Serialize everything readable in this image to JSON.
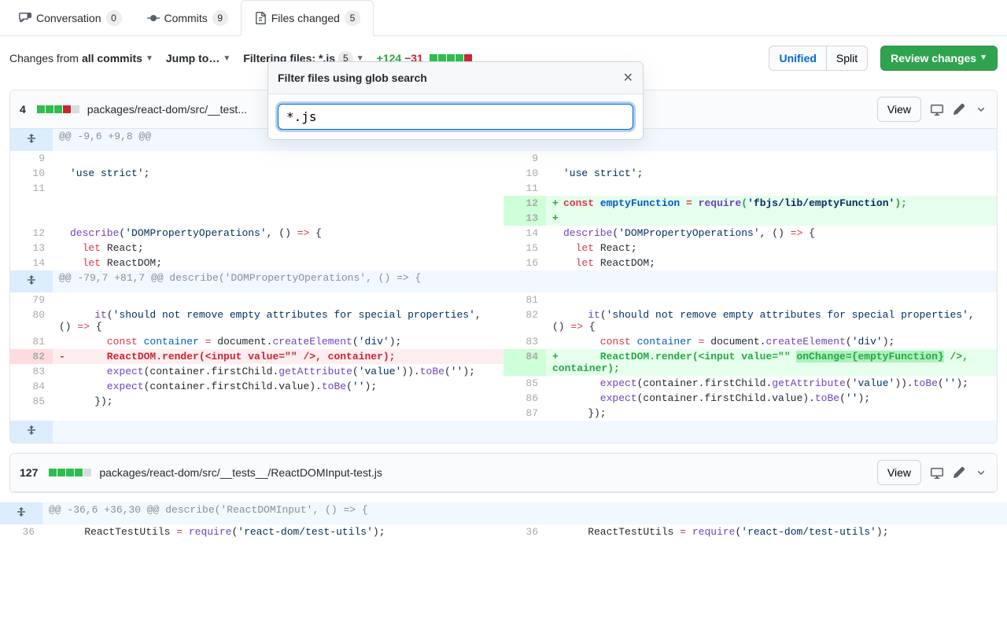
{
  "tabs": {
    "conversation": {
      "label": "Conversation",
      "count": "0"
    },
    "commits": {
      "label": "Commits",
      "count": "9"
    },
    "files": {
      "label": "Files changed",
      "count": "5"
    }
  },
  "toolbar": {
    "changes_from": "Changes from",
    "all_commits": "all commits",
    "jump_to": "Jump to…",
    "filtering": "Filtering files:",
    "filter_pattern": "*.js",
    "filter_count": "5",
    "additions": "+124",
    "deletions": "−31",
    "unified": "Unified",
    "split": "Split",
    "review": "Review changes"
  },
  "popover": {
    "title": "Filter files using glob search",
    "value": "*.js"
  },
  "file1": {
    "changes": "4",
    "path": "packages/react-dom/src/__test...",
    "view": "View",
    "hunk1": "@@ -9,6 +9,8 @@",
    "hunk2": "@@ -79,7 +81,7 @@ describe('DOMPropertyOperations', () => {",
    "left": {
      "l9": "9",
      "l10": "10",
      "l11": "11",
      "l12": "12",
      "l13": "13",
      "l14": "14",
      "l79": "79",
      "l80": "80",
      "l81": "81",
      "l82": "82",
      "l83": "83",
      "l84": "84",
      "l85": "85"
    },
    "right": {
      "l9": "9",
      "l10": "10",
      "l11": "11",
      "l12": "12",
      "l13": "13",
      "l14": "14",
      "l15": "15",
      "l16": "16",
      "l81": "81",
      "l82": "82",
      "l83": "83",
      "l84": "84",
      "l85": "85",
      "l86": "86",
      "l87": "87"
    },
    "code": {
      "use_strict": "'use strict';",
      "empty_fn_1": "const",
      "empty_fn_2": " emptyFunction ",
      "empty_fn_3": "=",
      "empty_fn_4": " require",
      "empty_fn_5": "(",
      "empty_fn_6": "'fbjs/lib/emptyFunction'",
      "empty_fn_7": ");",
      "describe_1": "describe",
      "describe_2": "(",
      "describe_3": "'DOMPropertyOperations'",
      "describe_4": ", () ",
      "describe_5": "=>",
      "describe_6": " {",
      "let_react_1": "  let",
      "let_react_2": " React;",
      "let_dom_1": "  let",
      "let_dom_2": " ReactDOM;",
      "it_1": "    it",
      "it_2": "(",
      "it_3": "'should not remove empty attributes for special properties'",
      "it_4": ", () ",
      "it_5": "=>",
      "it_6": " {",
      "const_cont_1": "      const",
      "const_cont_2": " container ",
      "const_cont_3": "=",
      "const_cont_4": " document.",
      "const_cont_5": "createElement",
      "const_cont_6": "(",
      "const_cont_7": "'div'",
      "const_cont_8": ");",
      "render_old": "      ReactDOM.render(<input value=\"\" />, container);",
      "render_new_1": "      ReactDOM.render(<input value=\"\" ",
      "render_new_hl": "onChange={emptyFunction}",
      "render_new_2": " />, container);",
      "expect1_1": "      expect",
      "expect1_2": "(container.firstChild.",
      "expect1_3": "getAttribute",
      "expect1_4": "(",
      "expect1_5": "'value'",
      "expect1_6": ")).",
      "expect1_7": "toBe",
      "expect1_8": "(",
      "expect1_9": "''",
      "expect1_10": ");",
      "expect2_1": "      expect",
      "expect2_2": "(container.firstChild.value).",
      "expect2_3": "toBe",
      "expect2_4": "(",
      "expect2_5": "''",
      "expect2_6": ");",
      "close": "    });"
    }
  },
  "file2": {
    "changes": "127",
    "path": "packages/react-dom/src/__tests__/ReactDOMInput-test.js",
    "view": "View",
    "hunk1": "@@ -36,6 +36,30 @@ describe('ReactDOMInput', () => {",
    "ln": "36",
    "code_1": "    ReactTestUtils ",
    "code_2": "=",
    "code_3": " require",
    "code_4": "(",
    "code_5": "'react-dom/test-utils'",
    "code_6": ");"
  }
}
